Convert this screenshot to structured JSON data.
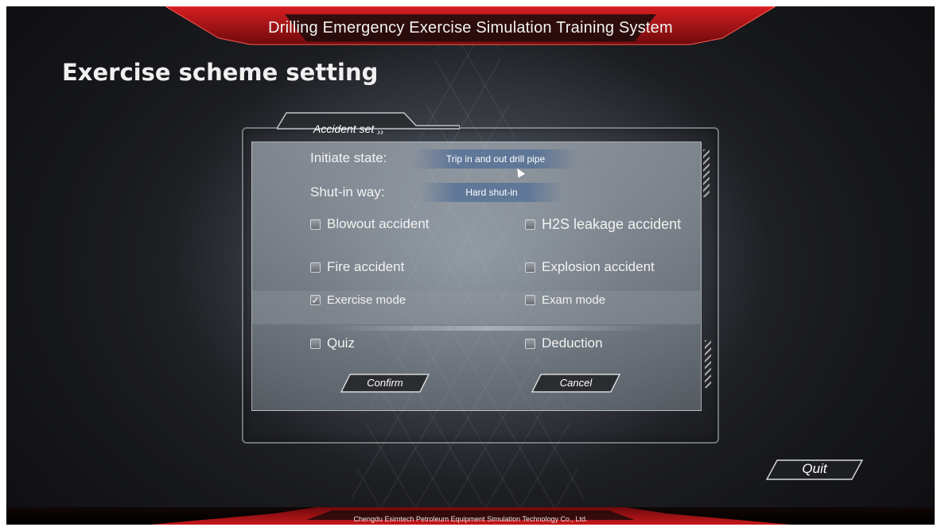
{
  "header": {
    "title": "Drilling Emergency Exercise Simulation Training System"
  },
  "page": {
    "title": "Exercise scheme setting"
  },
  "dialog": {
    "tab_label": "Accident set",
    "tab_chevrons": "››",
    "initiate_state": {
      "label": "Initiate state:",
      "value": "Trip in and out drill pipe"
    },
    "shutin_way": {
      "label": "Shut-in way:",
      "value": "Hard shut-in"
    },
    "accidents": [
      {
        "label": "Blowout accident",
        "checked": false
      },
      {
        "label": "H2S leakage accident",
        "checked": false
      },
      {
        "label": "Fire accident",
        "checked": false
      },
      {
        "label": "Explosion accident",
        "checked": false
      }
    ],
    "modes": [
      {
        "label": "Exercise mode",
        "checked": true
      },
      {
        "label": "Exam mode",
        "checked": false
      }
    ],
    "options": [
      {
        "label": "Quiz",
        "checked": false
      },
      {
        "label": "Deduction",
        "checked": false
      }
    ],
    "confirm_label": "Confirm",
    "cancel_label": "Cancel"
  },
  "quit_label": "Quit",
  "footer": {
    "text": "Chengdu Esimtech Petroleum Equipment Simulation Technology Co., Ltd."
  },
  "colors": {
    "accent_red": "#b3141a",
    "panel": "#aeb8c2"
  }
}
